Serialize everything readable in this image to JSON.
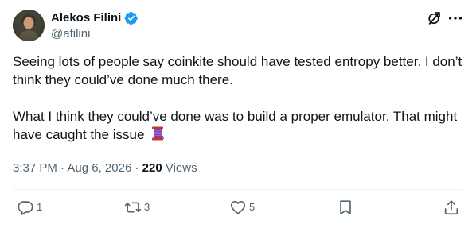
{
  "header": {
    "display_name": "Alekos Filini",
    "handle": "@afilini",
    "verified": true
  },
  "icons": {
    "avatar": "profile-photo",
    "verified": "verified-badge-icon",
    "grok": "grok-icon",
    "more": "more-options-icon",
    "reply": "reply-icon",
    "repost": "repost-icon",
    "like": "like-icon",
    "bookmark": "bookmark-icon",
    "share": "share-icon",
    "emoji": "thread-spool-emoji"
  },
  "tweet": {
    "paragraph_1": "Seeing lots of people say coinkite should have tested entropy better. I don’t think they could’ve done much there.",
    "paragraph_2": "What I think they could’ve done was to build a proper emulator. That might have caught the issue",
    "emoji": "🧵"
  },
  "meta": {
    "time": "3:37 PM",
    "separator_1": " · ",
    "date": "Aug 6, 2026",
    "separator_2": " · ",
    "views_count": "220",
    "views_label": " Views"
  },
  "actions": {
    "reply_count": "1",
    "repost_count": "3",
    "like_count": "5"
  },
  "colors": {
    "text_primary": "#0f1419",
    "text_secondary": "#536471",
    "verified_blue": "#1d9bf0",
    "divider": "#eff3f4",
    "spool_purple": "#7a3fb0",
    "spool_wood": "#c0392b"
  }
}
